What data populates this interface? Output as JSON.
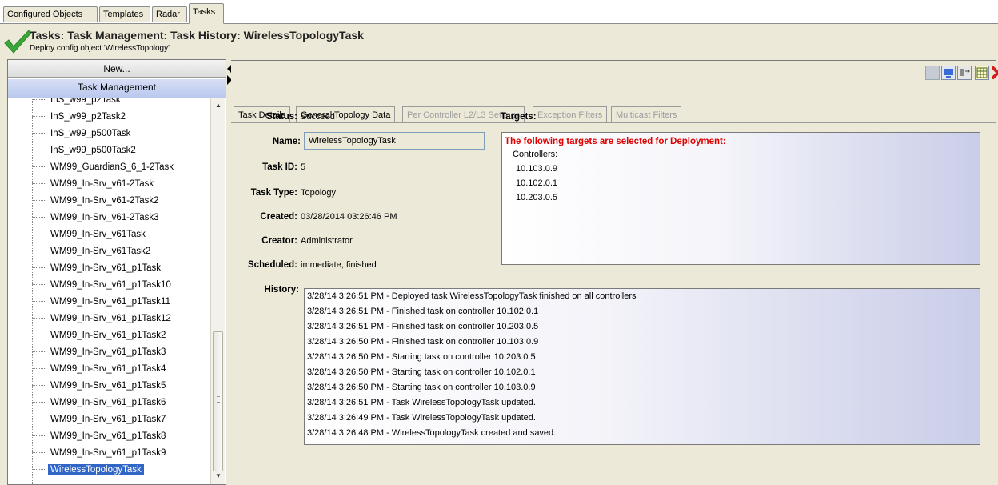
{
  "top_tabs": [
    "Configured Objects",
    "Templates",
    "Radar",
    "Tasks"
  ],
  "header": {
    "title": "Tasks: Task Management: Task History: WirelessTopologyTask",
    "subtitle": "Deploy config object 'WirelessTopology'"
  },
  "left": {
    "new_label": "New...",
    "section_label": "Task Management",
    "tree_items": [
      "InS_w99_p2Task",
      "InS_w99_p2Task2",
      "InS_w99_p500Task",
      "InS_w99_p500Task2",
      "WM99_GuardianS_6_1-2Task",
      "WM99_In-Srv_v61-2Task",
      "WM99_In-Srv_v61-2Task2",
      "WM99_In-Srv_v61-2Task3",
      "WM99_In-Srv_v61Task",
      "WM99_In-Srv_v61Task2",
      "WM99_In-Srv_v61_p1Task",
      "WM99_In-Srv_v61_p1Task10",
      "WM99_In-Srv_v61_p1Task11",
      "WM99_In-Srv_v61_p1Task12",
      "WM99_In-Srv_v61_p1Task2",
      "WM99_In-Srv_v61_p1Task3",
      "WM99_In-Srv_v61_p1Task4",
      "WM99_In-Srv_v61_p1Task5",
      "WM99_In-Srv_v61_p1Task6",
      "WM99_In-Srv_v61_p1Task7",
      "WM99_In-Srv_v61_p1Task8",
      "WM99_In-Srv_v61_p1Task9",
      "WirelessTopologyTask"
    ],
    "selected_item": "WirelessTopologyTask"
  },
  "content_tabs": [
    {
      "label": "Task Details",
      "state": "active"
    },
    {
      "label": "General Topology Data",
      "state": "normal"
    },
    {
      "label": "Per Controller L2/L3 Settings",
      "state": "disabled"
    },
    {
      "label": "Exception Filters",
      "state": "disabled"
    },
    {
      "label": "Multicast Filters",
      "state": "disabled"
    }
  ],
  "details": {
    "status_label": "Status:",
    "status_value": "Succeed",
    "name_label": "Name:",
    "name_value": "WirelessTopologyTask",
    "taskid_label": "Task ID:",
    "taskid_value": "5",
    "tasktype_label": "Task Type:",
    "tasktype_value": "Topology",
    "created_label": "Created:",
    "created_value": "03/28/2014 03:26:46 PM",
    "creator_label": "Creator:",
    "creator_value": "Administrator",
    "scheduled_label": "Scheduled:",
    "scheduled_value": "immediate, finished",
    "history_label": "History:",
    "targets_label": "Targets:"
  },
  "targets": {
    "title": "The following targets are selected for Deployment:",
    "heading": "Controllers:",
    "controllers": [
      "10.103.0.9",
      "10.102.0.1",
      "10.203.0.5"
    ]
  },
  "history": [
    "3/28/14 3:26:51 PM - Deployed task WirelessTopologyTask finished on all controllers",
    "3/28/14 3:26:51 PM - Finished task on controller 10.102.0.1",
    "3/28/14 3:26:51 PM - Finished task on controller 10.203.0.5",
    "3/28/14 3:26:50 PM - Finished task on controller 10.103.0.9",
    "3/28/14 3:26:50 PM - Starting task on controller 10.203.0.5",
    "3/28/14 3:26:50 PM - Starting task on controller 10.102.0.1",
    "3/28/14 3:26:50 PM - Starting task on controller 10.103.0.9",
    "3/28/14 3:26:51 PM - Task WirelessTopologyTask updated.",
    "3/28/14 3:26:49 PM - Task WirelessTopologyTask updated.",
    "3/28/14 3:26:48 PM - WirelessTopologyTask created and saved."
  ],
  "toolbar_icons": [
    "save-icon",
    "monitor-icon",
    "export-icon",
    "grid-icon",
    "close-icon"
  ],
  "colors": {
    "success_green": "#3aa63a",
    "targets_title_red": "#e00000",
    "selection_blue": "#3165c6",
    "close_red": "#d42020"
  }
}
